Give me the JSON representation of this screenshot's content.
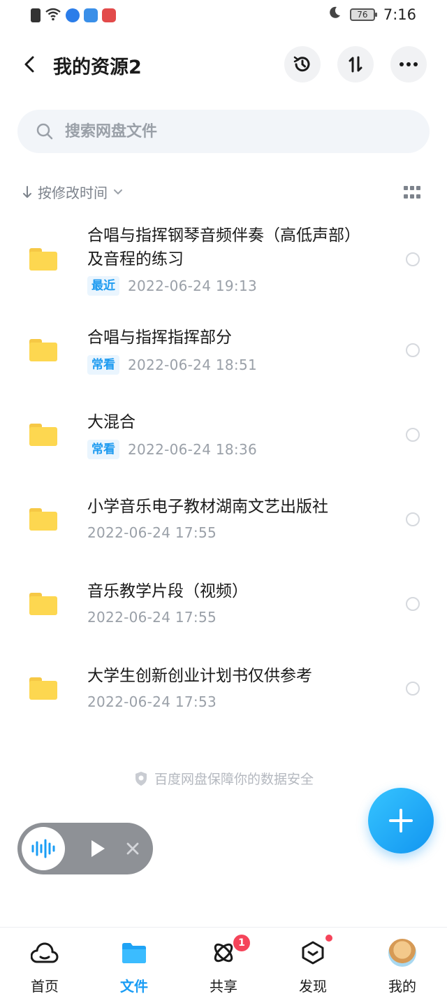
{
  "status_bar": {
    "battery": "76",
    "time": "7:16"
  },
  "header": {
    "title": "我的资源2"
  },
  "search": {
    "placeholder": "搜索网盘文件"
  },
  "sort": {
    "label": "按修改时间"
  },
  "files": [
    {
      "name": "合唱与指挥钢琴音频伴奏（高低声部）及音程的练习",
      "tag": "最近",
      "date": "2022-06-24  19:13"
    },
    {
      "name": "合唱与指挥指挥部分",
      "tag": "常看",
      "date": "2022-06-24  18:51"
    },
    {
      "name": "大混合",
      "tag": "常看",
      "date": "2022-06-24  18:36"
    },
    {
      "name": "小学音乐电子教材湖南文艺出版社",
      "tag": "",
      "date": "2022-06-24  17:55"
    },
    {
      "name": "音乐教学片段（视频）",
      "tag": "",
      "date": "2022-06-24  17:55"
    },
    {
      "name": "大学生创新创业计划书仅供参考",
      "tag": "",
      "date": "2022-06-24  17:53"
    }
  ],
  "security_note": "百度网盘保障你的数据安全",
  "bottom_nav": [
    {
      "label": "首页",
      "icon": "home-cloud-icon"
    },
    {
      "label": "文件",
      "icon": "folder-icon",
      "active": true
    },
    {
      "label": "共享",
      "icon": "share-atom-icon",
      "badge": "1"
    },
    {
      "label": "发现",
      "icon": "discover-box-icon",
      "dot": true
    },
    {
      "label": "我的",
      "icon": "avatar"
    }
  ],
  "colors": {
    "accent": "#1a9df5",
    "folder": "#fdd750",
    "badge": "#f5445a"
  }
}
